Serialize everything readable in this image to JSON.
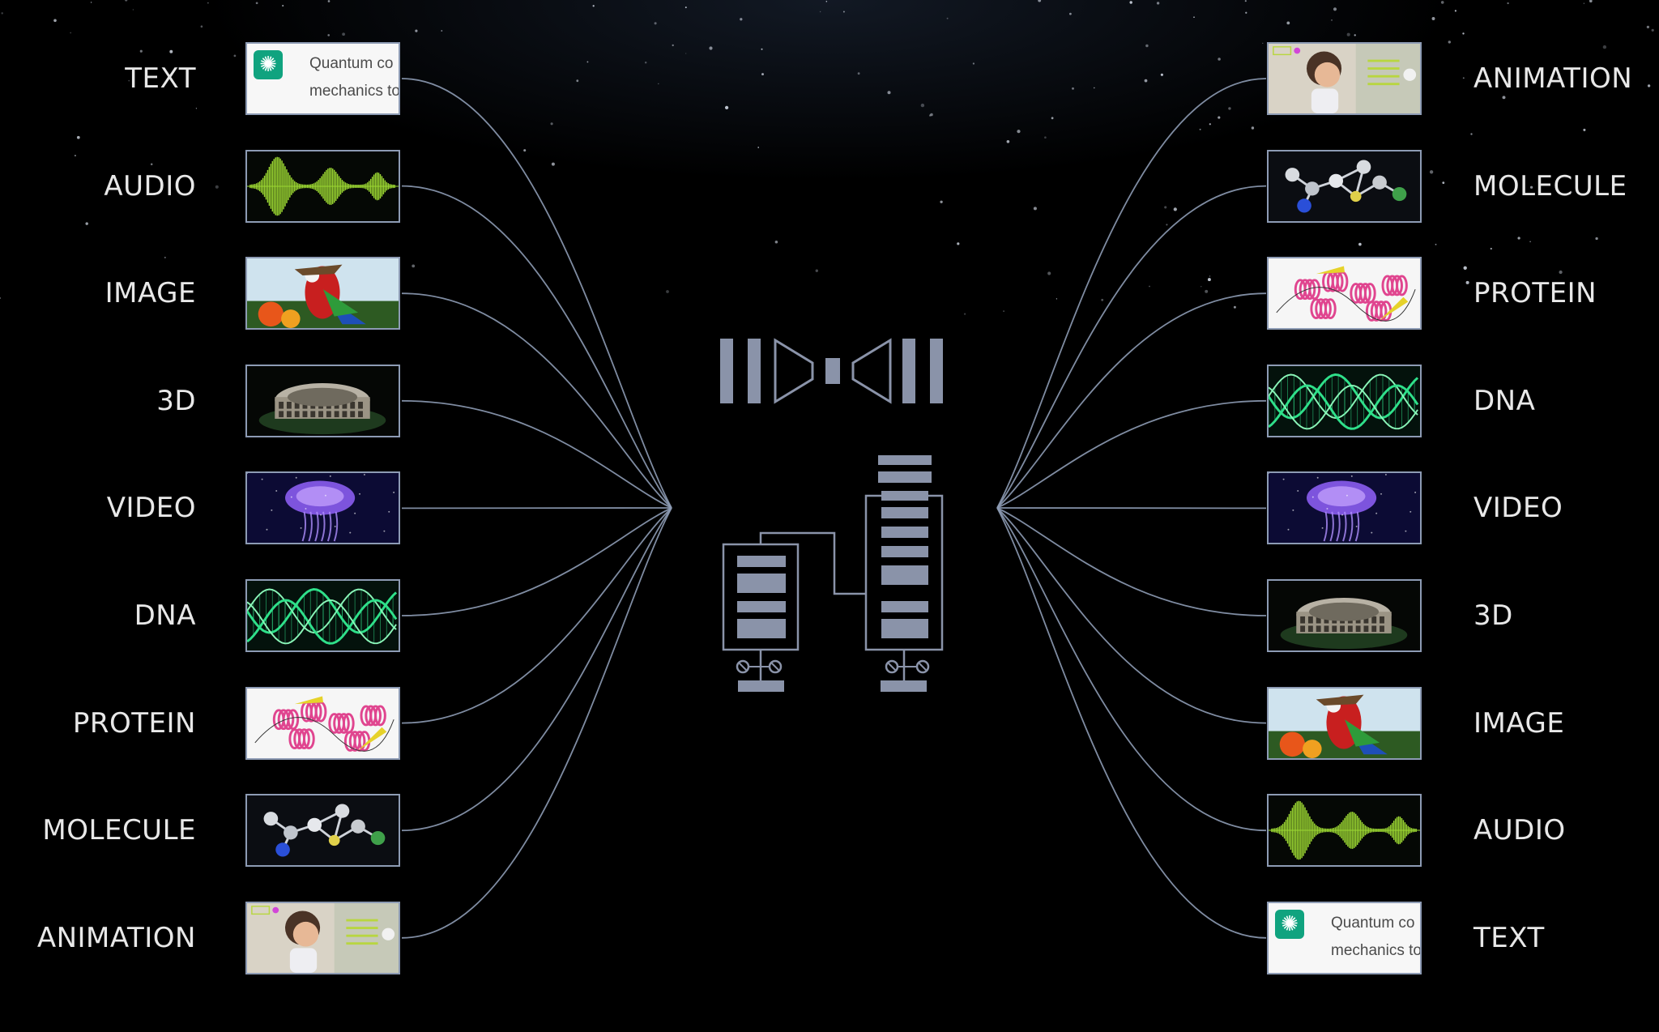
{
  "inputs": [
    {
      "label": "TEXT",
      "kind": "text"
    },
    {
      "label": "AUDIO",
      "kind": "audio"
    },
    {
      "label": "IMAGE",
      "kind": "image"
    },
    {
      "label": "3D",
      "kind": "3d"
    },
    {
      "label": "VIDEO",
      "kind": "video"
    },
    {
      "label": "DNA",
      "kind": "dna"
    },
    {
      "label": "PROTEIN",
      "kind": "protein"
    },
    {
      "label": "MOLECULE",
      "kind": "molecule"
    },
    {
      "label": "ANIMATION",
      "kind": "animation"
    }
  ],
  "outputs": [
    {
      "label": "ANIMATION",
      "kind": "animation"
    },
    {
      "label": "MOLECULE",
      "kind": "molecule"
    },
    {
      "label": "PROTEIN",
      "kind": "protein"
    },
    {
      "label": "DNA",
      "kind": "dna"
    },
    {
      "label": "VIDEO",
      "kind": "video"
    },
    {
      "label": "3D",
      "kind": "3d"
    },
    {
      "label": "IMAGE",
      "kind": "image"
    },
    {
      "label": "AUDIO",
      "kind": "audio"
    },
    {
      "label": "TEXT",
      "kind": "text"
    }
  ],
  "text_snippet": {
    "line1": "Quantum co",
    "line2": "mechanics to"
  },
  "icons": {
    "chat": "chatgpt-logo-icon"
  },
  "colors": {
    "background": "#000000",
    "wire": "#8d9bb4",
    "block": "#8a93a9",
    "label": "#e8e8e8",
    "audio_wave": "#9cd832",
    "dna": "#2fe08a",
    "video": "#8a5cf0",
    "chat_brand": "#10a37f"
  }
}
